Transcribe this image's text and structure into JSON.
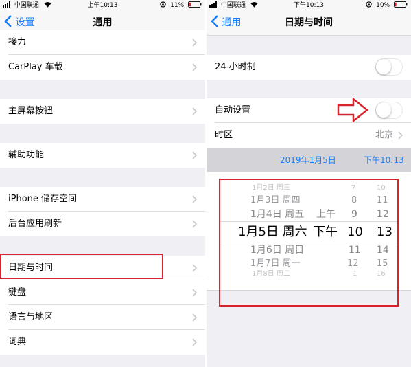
{
  "colors": {
    "accent": "#157efb",
    "highlight": "#d6232c",
    "background": "#efeff4"
  },
  "left_screen": {
    "status": {
      "carrier": "中国联通",
      "time": "上午10:13",
      "battery": "11%"
    },
    "nav": {
      "back_label": "设置",
      "title": "通用"
    },
    "items": [
      {
        "label": "接力"
      },
      {
        "label": "CarPlay 车载"
      },
      {
        "label": "主屏幕按钮"
      },
      {
        "label": "辅助功能"
      },
      {
        "label": "iPhone 储存空间"
      },
      {
        "label": "后台应用刷新"
      },
      {
        "label": "日期与时间"
      },
      {
        "label": "键盘"
      },
      {
        "label": "语言与地区"
      },
      {
        "label": "词典"
      }
    ]
  },
  "right_screen": {
    "status": {
      "carrier": "中国联通",
      "time": "下午10:13",
      "battery": "10%"
    },
    "nav": {
      "back_label": "通用",
      "title": "日期与时间"
    },
    "toggle_24h": {
      "label": "24 小时制",
      "on": false
    },
    "toggle_auto": {
      "label": "自动设置",
      "on": false
    },
    "timezone": {
      "label": "时区",
      "value": "北京"
    },
    "current_date": "2019年1月5日",
    "current_time": "下午10:13",
    "picker": {
      "rows": [
        {
          "date": "1月2日 周三",
          "ampm": "",
          "hour": "7",
          "minute": "10"
        },
        {
          "date": "1月3日 周四",
          "ampm": "",
          "hour": "8",
          "minute": "11"
        },
        {
          "date": "1月4日 周五",
          "ampm": "上午",
          "hour": "9",
          "minute": "12"
        },
        {
          "date": "1月5日 周六",
          "ampm": "下午",
          "hour": "10",
          "minute": "13"
        },
        {
          "date": "1月6日 周日",
          "ampm": "",
          "hour": "11",
          "minute": "14"
        },
        {
          "date": "1月7日 周一",
          "ampm": "",
          "hour": "12",
          "minute": "15"
        },
        {
          "date": "1月8日 周二",
          "ampm": "",
          "hour": "1",
          "minute": "16"
        }
      ]
    }
  }
}
